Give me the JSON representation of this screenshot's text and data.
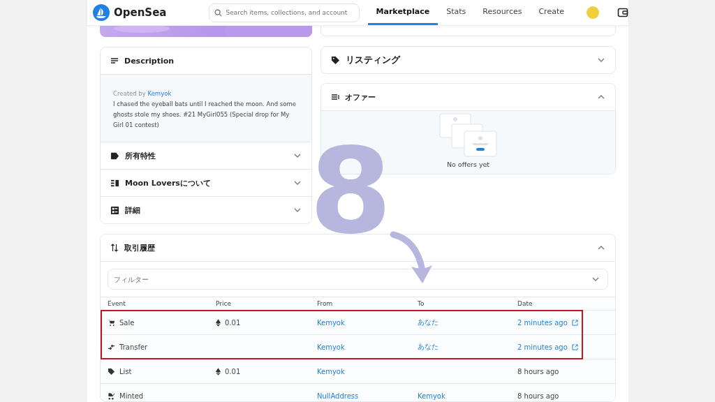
{
  "header": {
    "logo": "OpenSea",
    "search": {
      "placeholder": "Search items, collections, and account"
    },
    "nav": [
      {
        "label": "Marketplace",
        "selected": true
      },
      {
        "label": "Stats",
        "selected": false
      },
      {
        "label": "Resources",
        "selected": false
      },
      {
        "label": "Create",
        "selected": false
      }
    ]
  },
  "description": {
    "title": "Description",
    "created_by": "Created by",
    "creator": "Kemyok",
    "text": "I chased the eyeball bats until I reached the moon. And some ghosts stole my shoes. #21 MyGirl055 (Special drop for My Girl 01 contest)"
  },
  "left_sections": [
    {
      "kind": "tag",
      "title": "所有特性",
      "expanded": false
    },
    {
      "kind": "list",
      "title": "Moon Loversについて",
      "expanded": false
    },
    {
      "kind": "details",
      "title": "詳細",
      "expanded": false
    }
  ],
  "listing": {
    "title": "リスティング",
    "expanded": false
  },
  "offers": {
    "title": "オファー",
    "expanded": true,
    "empty_text": "No offers yet"
  },
  "history": {
    "title": "取引履歴",
    "expanded": true,
    "filter": {
      "placeholder": "フィルター"
    },
    "columns": [
      "Event",
      "Price",
      "From",
      "To",
      "Date"
    ],
    "rows": [
      {
        "kind": "sale",
        "event": "Sale",
        "price": "0.01",
        "from": "Kemyok",
        "to": "あなた",
        "date": "2 minutes ago",
        "date_link": true,
        "highlighted": true
      },
      {
        "kind": "transfer",
        "event": "Transfer",
        "price": "",
        "from": "Kemyok",
        "to": "あなた",
        "date": "2 minutes ago",
        "date_link": true,
        "highlighted": true
      },
      {
        "kind": "list",
        "event": "List",
        "price": "0.01",
        "from": "Kemyok",
        "to": "",
        "date": "8 hours ago",
        "date_link": false,
        "highlighted": false
      },
      {
        "kind": "minted",
        "event": "Minted",
        "price": "",
        "from": "NullAddress",
        "to": "Kemyok",
        "date": "8 hours ago",
        "date_link": false,
        "highlighted": false
      }
    ]
  },
  "annotation": {
    "step_number": "8"
  }
}
